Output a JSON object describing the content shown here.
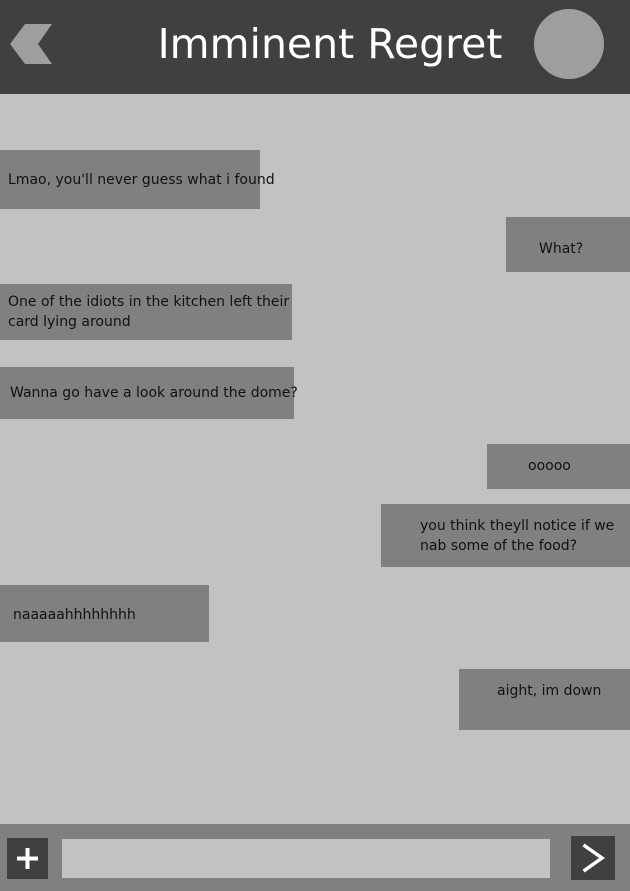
{
  "header": {
    "title": "Imminent Regret",
    "back_icon": "chevron-left-icon",
    "avatar": "contact-avatar"
  },
  "messages": [
    {
      "side": "incoming",
      "lines": [
        "Lmao, you'll never guess what i found"
      ]
    },
    {
      "side": "outgoing",
      "lines": [
        "What?"
      ]
    },
    {
      "side": "incoming",
      "lines": [
        "One of the idiots in the kitchen left their",
        "card lying around"
      ]
    },
    {
      "side": "incoming",
      "lines": [
        "Wanna go have a look around the dome?"
      ]
    },
    {
      "side": "outgoing",
      "lines": [
        "ooooo"
      ]
    },
    {
      "side": "outgoing",
      "lines": [
        "you think theyll notice if we",
        "nab some of the food?"
      ]
    },
    {
      "side": "incoming",
      "lines": [
        "naaaaahhhhhhhh"
      ]
    },
    {
      "side": "outgoing",
      "lines": [
        "aight, im down"
      ]
    }
  ],
  "composer": {
    "value": "",
    "placeholder": "",
    "add_icon": "plus-icon",
    "send_icon": "send-arrow-icon"
  },
  "colors": {
    "header_bg": "#404040",
    "chat_bg": "#c2c2c2",
    "bubble_bg": "#808080",
    "avatar_bg": "#9e9e9e",
    "footer_bg": "#808080",
    "button_bg": "#404040"
  }
}
